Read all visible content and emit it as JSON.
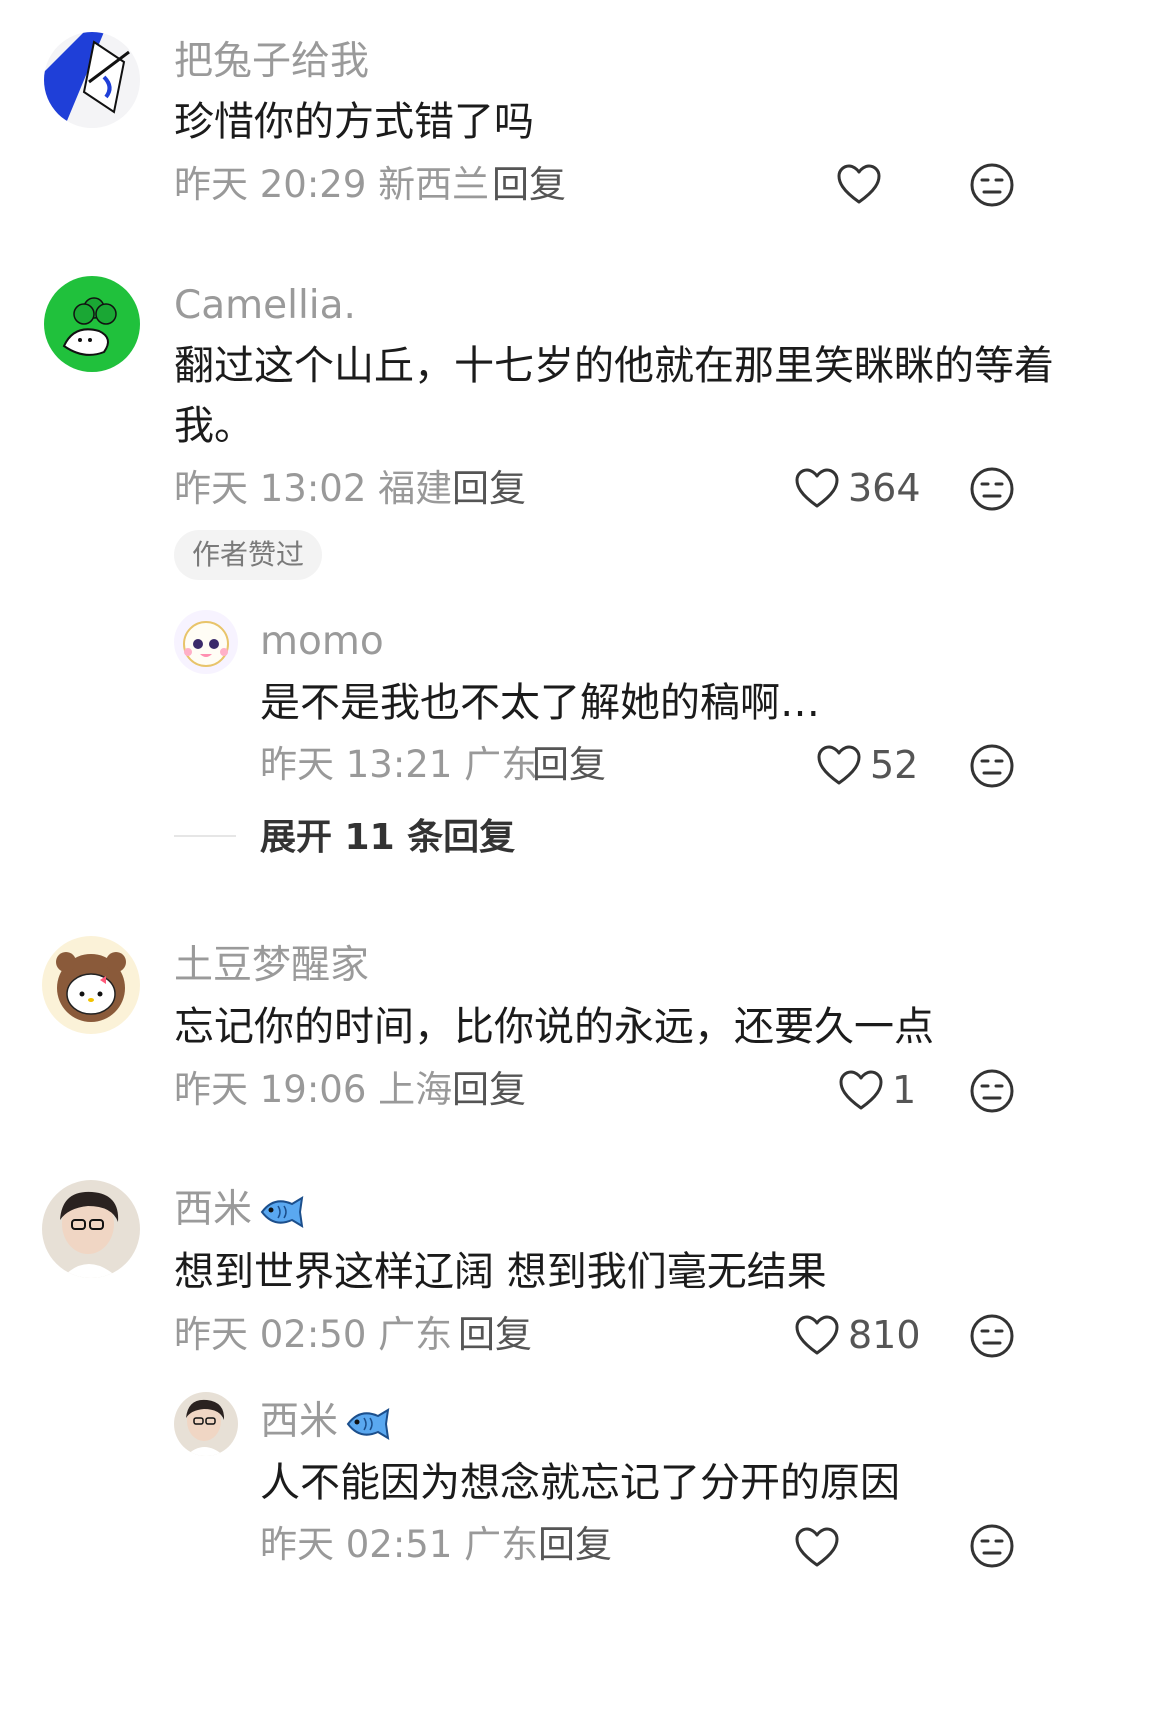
{
  "comments": [
    {
      "username": "把兔子给我",
      "text": "珍惜你的方式错了吗",
      "meta": "昨天 20:29 新西兰",
      "reply": "回复",
      "likes": ""
    },
    {
      "username": "Camellia.",
      "text_line1": "翻过这个山丘，十七岁的他就在那里笑眯眯的等着",
      "text_line2": "我。",
      "meta": "昨天 13:02 福建",
      "reply": "回复",
      "likes": "364",
      "badge": "作者赞过",
      "sub_reply": {
        "username": "momo",
        "text": "是不是我也不太了解她的稿啊…",
        "meta": "昨天 13:21 广东",
        "reply": "回复",
        "likes": "52"
      },
      "expand": "展开 11 条回复"
    },
    {
      "username": "土豆梦醒家",
      "text": "忘记你的时间，比你说的永远，还要久一点",
      "meta": "昨天 19:06 上海",
      "reply": "回复",
      "likes": "1"
    },
    {
      "username": "西米",
      "text": "想到世界这样辽阔 想到我们毫无结果",
      "meta": "昨天 02:50 广东",
      "reply": "回复",
      "likes": "810",
      "sub_reply": {
        "username": "西米",
        "text": "人不能因为想念就忘记了分开的原因",
        "meta": "昨天 02:51 广东",
        "reply": "回复"
      }
    }
  ],
  "watermark": "",
  "colors": {
    "username": "#9a9a9a",
    "text": "#1b1b1b",
    "meta": "#999999",
    "icon": "#333333",
    "badge_bg": "#f3f3f3"
  }
}
